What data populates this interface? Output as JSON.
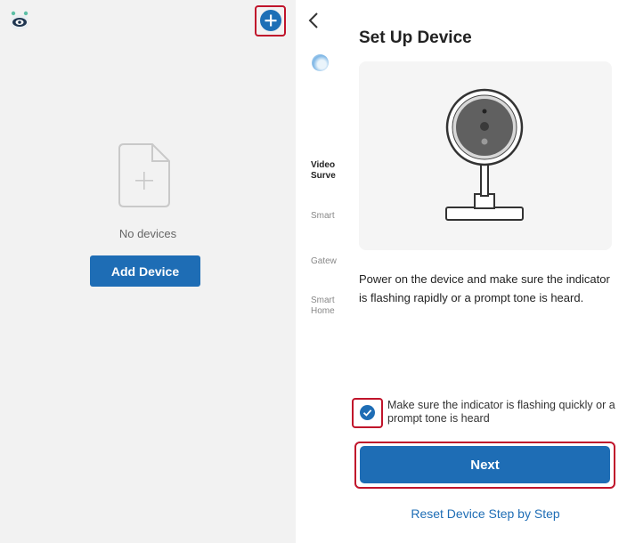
{
  "left_panel": {
    "logo_icon": "eye-robot-logo",
    "add_icon": "plus-icon",
    "empty_icon": "empty-file-plus-icon",
    "empty_text": "No devices",
    "add_device_label": "Add Device"
  },
  "right_panel": {
    "back_icon": "chevron-left-icon",
    "categories": [
      {
        "label": "Video",
        "active": true
      },
      {
        "label": "Surve",
        "active": true
      },
      {
        "label": "Smart",
        "active": false
      },
      {
        "label": "Gatew",
        "active": false
      },
      {
        "label": "Smart",
        "active": false
      },
      {
        "label": "Home",
        "active": false
      }
    ],
    "title": "Set Up Device",
    "illustration": "camera-icon",
    "instruction": "Power on the device and make sure the indicator is flashing rapidly or a prompt tone is heard.",
    "checkbox_checked": true,
    "checkbox_label": "Make sure the indicator is flashing quickly or a prompt tone is heard",
    "next_label": "Next",
    "reset_label": "Reset Device Step by Step"
  },
  "colors": {
    "primary": "#1e6db5",
    "highlight": "#c0142b",
    "left_bg": "#f2f2f2"
  }
}
